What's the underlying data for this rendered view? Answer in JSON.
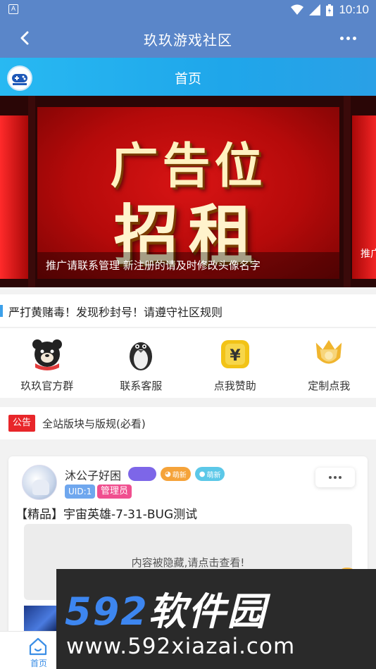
{
  "status_bar": {
    "notification_icon": "A",
    "time": "10:10",
    "icons": [
      "wifi-icon",
      "signal-icon",
      "battery-icon"
    ]
  },
  "title_bar": {
    "back_icon": "chevron-left-icon",
    "title": "玖玖游戏社区",
    "more_icon": "more-horizontal-icon"
  },
  "home_bar": {
    "title": "首页"
  },
  "banner": {
    "line1": "广告位",
    "line2": "招租",
    "caption": "推广请联系管理 新注册的请及时修改头像名字",
    "next_caption": "推广"
  },
  "notice": {
    "text": "严打黄赌毒！发现秒封号！请遵守社区规则"
  },
  "quick_links": [
    {
      "label": "玖玖官方群",
      "icon": "bear-icon"
    },
    {
      "label": "联系客服",
      "icon": "penguin-icon"
    },
    {
      "label": "点我赞助",
      "icon": "yuan-icon"
    },
    {
      "label": "定制点我",
      "icon": "crown-shield-icon"
    }
  ],
  "announcement": {
    "tag": "公告",
    "text": "全站版块与版规(必看)"
  },
  "post": {
    "username": "沐公子好困",
    "uid": "UID:1",
    "role": "管理员",
    "title": "【精品】宇宙英雄-7-31-BUG测试",
    "hidden_notice": "内容被隐藏,请点击查看!",
    "badges": [
      {
        "label": "",
        "color": "#7d66e8"
      },
      {
        "label": "萌新",
        "color": "#f5a33a"
      },
      {
        "label": "萌新",
        "color": "#5cc8e8"
      }
    ]
  },
  "tab_bar": {
    "home_label": "首页"
  },
  "watermark": {
    "line1_num": "592",
    "line1_text": "软件园",
    "line2": "www.592xiazai.com"
  },
  "colors": {
    "header_blue": "#5a86c9",
    "home_bar_cyan": "#1fa6ea",
    "announce_red": "#e8262a",
    "uid_blue": "#6fa7ee",
    "admin_pink": "#f04f8f"
  }
}
